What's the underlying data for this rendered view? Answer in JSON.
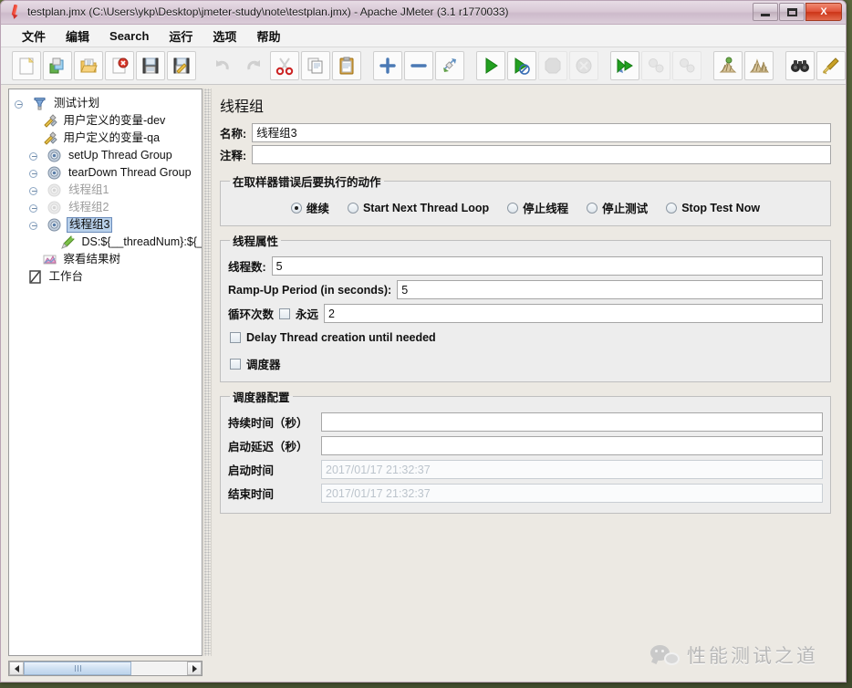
{
  "window": {
    "title": "testplan.jmx (C:\\Users\\ykp\\Desktop\\jmeter-study\\note\\testplan.jmx) - Apache JMeter (3.1 r1770033)",
    "app_icon": "jmeter-pen-icon",
    "minimize_label": "",
    "maximize_label": "",
    "close_label": "X"
  },
  "menubar": {
    "items": [
      {
        "label": "文件",
        "name": "menu-file"
      },
      {
        "label": "编辑",
        "name": "menu-edit"
      },
      {
        "label": "Search",
        "name": "menu-search"
      },
      {
        "label": "运行",
        "name": "menu-run"
      },
      {
        "label": "选项",
        "name": "menu-options"
      },
      {
        "label": "帮助",
        "name": "menu-help"
      }
    ]
  },
  "toolbar": {
    "buttons": [
      {
        "icon": "new-document-icon",
        "enabled": true
      },
      {
        "icon": "templates-icon",
        "enabled": true
      },
      {
        "icon": "open-folder-icon",
        "enabled": true
      },
      {
        "icon": "close-document-icon",
        "enabled": true
      },
      {
        "icon": "save-icon",
        "enabled": true
      },
      {
        "icon": "save-as-icon",
        "enabled": true
      },
      {
        "icon": "undo-icon",
        "enabled": false
      },
      {
        "icon": "redo-icon",
        "enabled": false
      },
      {
        "icon": "cut-scissors-icon",
        "enabled": true
      },
      {
        "icon": "copy-icon",
        "enabled": true
      },
      {
        "icon": "paste-clipboard-icon",
        "enabled": true
      },
      {
        "icon": "expand-all-plus-icon",
        "enabled": true
      },
      {
        "icon": "collapse-all-minus-icon",
        "enabled": true
      },
      {
        "icon": "toggle-icon",
        "enabled": true
      },
      {
        "icon": "start-play-icon",
        "enabled": true
      },
      {
        "icon": "start-no-timers-icon",
        "enabled": true
      },
      {
        "icon": "stop-icon",
        "enabled": false
      },
      {
        "icon": "shutdown-icon",
        "enabled": false
      },
      {
        "icon": "remote-start-all-icon",
        "enabled": true
      },
      {
        "icon": "remote-stop-all-icon",
        "enabled": false
      },
      {
        "icon": "remote-shutdown-all-icon",
        "enabled": false
      },
      {
        "icon": "clear-icon",
        "enabled": true
      },
      {
        "icon": "clear-all-icon",
        "enabled": true
      },
      {
        "icon": "search-binoculars-icon",
        "enabled": true
      },
      {
        "icon": "reset-search-broom-icon",
        "enabled": true
      }
    ]
  },
  "tree": {
    "nodes": [
      {
        "label": "测试计划",
        "icon": "test-plan-icon",
        "depth": 0,
        "state": "normal",
        "expander": "expanded"
      },
      {
        "label": "用户定义的变量-dev",
        "icon": "user-variables-icon",
        "depth": 1,
        "state": "normal",
        "expander": "none"
      },
      {
        "label": "用户定义的变量-qa",
        "icon": "user-variables-icon",
        "depth": 1,
        "state": "normal",
        "expander": "none"
      },
      {
        "label": "setUp Thread Group",
        "icon": "thread-group-icon",
        "depth": 1,
        "state": "normal",
        "expander": "collapsed"
      },
      {
        "label": "tearDown Thread Group",
        "icon": "thread-group-icon",
        "depth": 1,
        "state": "normal",
        "expander": "collapsed"
      },
      {
        "label": "线程组1",
        "icon": "thread-group-icon",
        "depth": 1,
        "state": "disabled",
        "expander": "collapsed"
      },
      {
        "label": "线程组2",
        "icon": "thread-group-icon",
        "depth": 1,
        "state": "disabled",
        "expander": "collapsed"
      },
      {
        "label": "线程组3",
        "icon": "thread-group-icon",
        "depth": 1,
        "state": "selected",
        "expander": "expanded"
      },
      {
        "label": "DS:${__threadNum}:${_",
        "icon": "debug-sampler-icon",
        "depth": 2,
        "state": "normal",
        "expander": "none"
      },
      {
        "label": "察看结果树",
        "icon": "view-results-tree-icon",
        "depth": 1,
        "state": "normal",
        "expander": "none"
      },
      {
        "label": "工作台",
        "icon": "workbench-icon",
        "depth": 0,
        "state": "normal",
        "expander": "none"
      }
    ],
    "selected_color": "#b8d0ea"
  },
  "scrollbar": {
    "left_arrow": "scroll-left-arrow",
    "right_arrow": "scroll-right-arrow",
    "thumb": "scroll-thumb"
  },
  "panel": {
    "title": "线程组",
    "name_label": "名称:",
    "name_value": "线程组3",
    "comment_label": "注释:",
    "comment_value": "",
    "on_error": {
      "legend": "在取样器错误后要执行的动作",
      "options": [
        {
          "label": "继续",
          "selected": true
        },
        {
          "label": "Start Next Thread Loop",
          "selected": false
        },
        {
          "label": "停止线程",
          "selected": false
        },
        {
          "label": "停止测试",
          "selected": false
        },
        {
          "label": "Stop Test Now",
          "selected": false
        }
      ]
    },
    "thread_properties": {
      "legend": "线程属性",
      "num_threads_label": "线程数:",
      "num_threads_value": "5",
      "ramp_up_label": "Ramp-Up Period (in seconds):",
      "ramp_up_value": "5",
      "loop_count_label": "循环次数",
      "forever_label": "永远",
      "forever_checked": false,
      "loop_count_value": "2",
      "delay_creation_label": "Delay Thread creation until needed",
      "delay_creation_checked": false,
      "scheduler_label": "调度器",
      "scheduler_checked": false
    },
    "scheduler_config": {
      "legend": "调度器配置",
      "duration_label": "持续时间（秒）",
      "duration_value": "",
      "startup_delay_label": "启动延迟（秒）",
      "startup_delay_value": "",
      "start_time_label": "启动时间",
      "start_time_value": "2017/01/17 21:32:37",
      "end_time_label": "结束时间",
      "end_time_value": "2017/01/17 21:32:37"
    }
  },
  "watermark": {
    "icon": "wechat-icon",
    "text": "性能测试之道"
  }
}
